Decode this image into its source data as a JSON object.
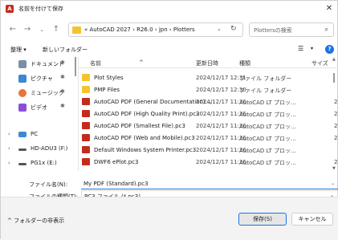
{
  "title": "名前を付けて保存",
  "nav": {
    "breadcrumb": "« AutoCAD 2027 › R26.0 › jpn › Plotters",
    "search_placeholder": "Plottersの検索"
  },
  "commandbar": {
    "organize": "整理 ▾",
    "new_folder": "新しいフォルダー"
  },
  "sidebar": {
    "items": [
      {
        "label": "ドキュメント",
        "pinned": true
      },
      {
        "label": "ピクチャ",
        "pinned": true
      },
      {
        "label": "ミュージック",
        "pinned": true
      },
      {
        "label": "ビデオ",
        "pinned": true
      },
      {
        "label": "PC"
      },
      {
        "label": "HD-ADU3 (F:)"
      },
      {
        "label": "PG1x (E:)"
      }
    ]
  },
  "columns": {
    "name": "名前",
    "date": "更新日時",
    "type": "種類",
    "size": "サイズ"
  },
  "files": [
    {
      "name": "Plot Styles",
      "date": "2024/12/17 12:31",
      "type": "ファイル フォルダー",
      "size": "",
      "icon": "folder-icon"
    },
    {
      "name": "PMP Files",
      "date": "2024/12/17 12:30",
      "type": "ファイル フォルダー",
      "size": "",
      "icon": "folder-icon"
    },
    {
      "name": "AutoCAD PDF (General Documentation)....",
      "date": "2024/12/17 11:36",
      "type": "AutoCAD LT プロッ...",
      "size": "2",
      "icon": "pc3-file-icon"
    },
    {
      "name": "AutoCAD PDF (High Quality Print).pc3",
      "date": "2024/12/17 11:36",
      "type": "AutoCAD LT プロッ...",
      "size": "2",
      "icon": "pc3-file-icon"
    },
    {
      "name": "AutoCAD PDF (Smallest File).pc3",
      "date": "2024/12/17 11:36",
      "type": "AutoCAD LT プロッ...",
      "size": "2",
      "icon": "pc3-file-icon"
    },
    {
      "name": "AutoCAD PDF (Web and Mobile).pc3",
      "date": "2024/12/17 11:36",
      "type": "AutoCAD LT プロッ...",
      "size": "2",
      "icon": "pc3-file-icon"
    },
    {
      "name": "Default Windows System Printer.pc3",
      "date": "2024/12/17 11:36",
      "type": "AutoCAD LT プロッ...",
      "size": "",
      "icon": "pc3-file-icon"
    },
    {
      "name": "DWF6 ePlot.pc3",
      "date": "2024/12/17 11:36",
      "type": "AutoCAD LT プロッ...",
      "size": "2",
      "icon": "pc3-file-icon"
    }
  ],
  "filename": {
    "label": "ファイル名(N):",
    "value": "My PDF (Standard).pc3"
  },
  "filetype": {
    "label": "ファイルの種類(T):",
    "value": "PC3 ファイル (*.pc3)"
  },
  "footer": {
    "hide_folders": "フォルダーの非表示",
    "save": "保存(S)",
    "cancel": "キャンセル"
  },
  "colors": {
    "accent": "#1a73e8",
    "folder": "#f4c430",
    "file_icon": "#c42b1c"
  }
}
